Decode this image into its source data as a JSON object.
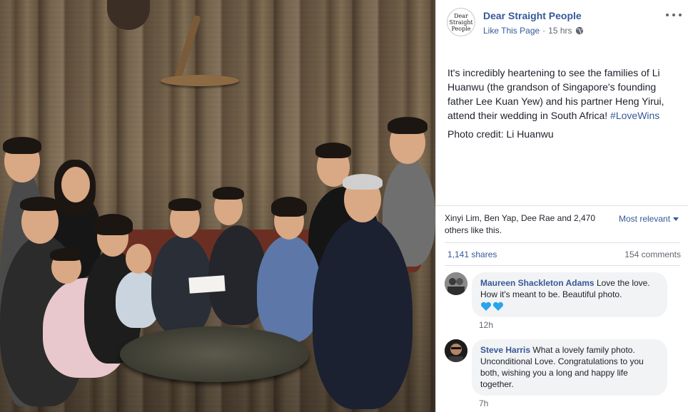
{
  "post": {
    "page_name": "Dear Straight People",
    "avatar_text": "Dear Straight People",
    "like_page": "Like This Page",
    "separator": "·",
    "time": "15 hrs",
    "privacy_icon": "globe-icon",
    "text": "It's incredibly heartening to see the families of Li Huanwu (the grandson of Singapore's founding father Lee Kuan Yew) and his partner Heng Yirui, attend their wedding in South Africa!",
    "hashtag": "#LoveWins",
    "credit": "Photo credit: Li Huanwu"
  },
  "reactions": {
    "likes": "Xinyi Lim, Ben Yap, Dee Rae and 2,470 others like this.",
    "sort_label": "Most relevant",
    "shares": "1,141 shares",
    "comments": "154 comments"
  },
  "comments": [
    {
      "author": "Maureen Shackleton Adams",
      "text": "Love the love. How it's meant to be. Beautiful photo.",
      "emoji": "blue-heart-icon x2",
      "time": "12h"
    },
    {
      "author": "Steve Harris",
      "text": "What a lovely family photo. Unconditional Love. Congratulations to you both, wishing you a long and happy life together.",
      "time": "7h"
    }
  ],
  "colors": {
    "link": "#365899",
    "comment_bubble": "#f2f3f5",
    "heart": "#2aa3ef"
  }
}
